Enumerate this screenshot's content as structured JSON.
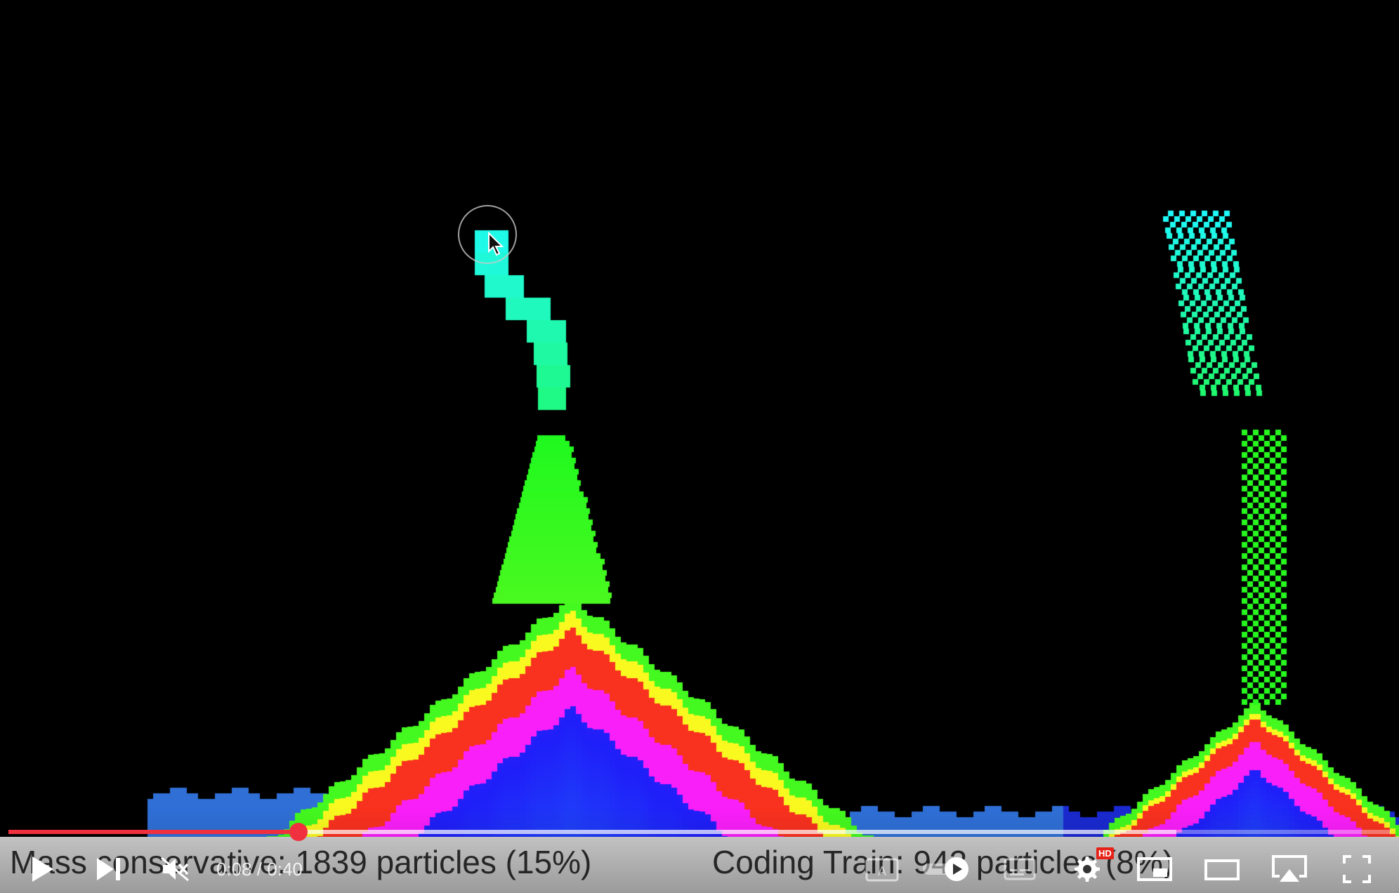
{
  "captions": {
    "left": "Mass conservative: 1839 particles (15%)",
    "right": "Coding Train: 942 particles (8%)"
  },
  "player": {
    "time_current": "0:08",
    "time_total": "0:40",
    "time_display": "0:08 / 0:40",
    "progress_played_fraction": 0.21,
    "progress_loaded_fraction": 0.845,
    "muted": true,
    "hd_badge": "HD"
  },
  "icons": {
    "play": "play-icon",
    "next": "next-icon",
    "mute": "mute-icon",
    "subtitles": "subtitles-icon",
    "settings": "gear-icon",
    "miniplayer": "miniplayer-icon",
    "theater": "theater-icon",
    "airplay": "airplay-icon",
    "fullscreen": "fullscreen-icon"
  },
  "colors": {
    "progress_played": "#f0303f",
    "background": "#000000"
  }
}
